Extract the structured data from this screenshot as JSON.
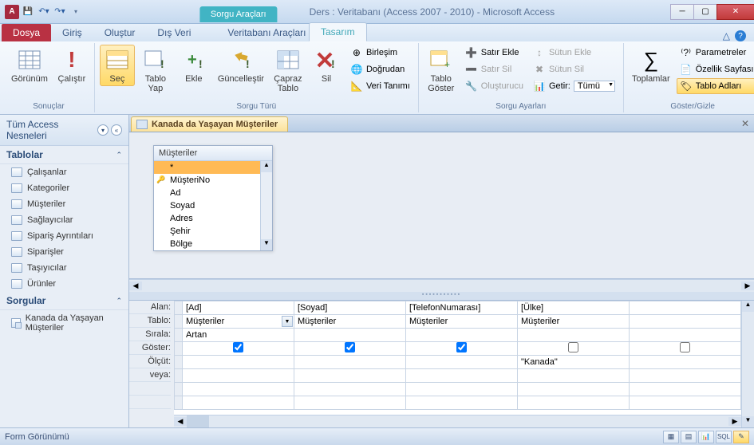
{
  "title": "Ders : Veritabanı (Access 2007 - 2010)  -  Microsoft Access",
  "contextual_tab_group": "Sorgu Araçları",
  "tabs": {
    "dosya": "Dosya",
    "giris": "Giriş",
    "olustur": "Oluştur",
    "disveri": "Dış Veri",
    "vt_araclari": "Veritabanı Araçları",
    "tasarim": "Tasarım"
  },
  "ribbon": {
    "sonuclar": {
      "label": "Sonuçlar",
      "gorunum": "Görünüm",
      "calistir": "Çalıştır"
    },
    "sorgu_turu": {
      "label": "Sorgu Türü",
      "sec": "Seç",
      "tablo_yap": "Tablo\nYap",
      "ekle": "Ekle",
      "guncelle": "Güncelleştir",
      "capraz": "Çapraz\nTablo",
      "sil": "Sil",
      "birlesim": "Birleşim",
      "dogrudan": "Doğrudan",
      "veri_tanimi": "Veri Tanımı"
    },
    "sorgu_ayarlari": {
      "label": "Sorgu Ayarları",
      "tablo_goster": "Tablo\nGöster",
      "satir_ekle": "Satır Ekle",
      "satir_sil": "Satır Sil",
      "olusturucu": "Oluşturucu",
      "sutun_ekle": "Sütun Ekle",
      "sutun_sil": "Sütun Sil",
      "getir": "Getir:",
      "getir_val": "Tümü"
    },
    "goster_gizle": {
      "label": "Göster/Gizle",
      "toplamlar": "Toplamlar",
      "parametreler": "Parametreler",
      "ozellik": "Özellik Sayfası",
      "tablo_adlari": "Tablo Adları"
    }
  },
  "nav": {
    "header": "Tüm Access Nesneleri",
    "tablolar": "Tablolar",
    "sorgular": "Sorgular",
    "items_tables": [
      "Çalışanlar",
      "Kategoriler",
      "Müşteriler",
      "Sağlayıcılar",
      "Sipariş Ayrıntıları",
      "Siparişler",
      "Taşıyıcılar",
      "Ürünler"
    ],
    "items_queries": [
      "Kanada da Yaşayan Müşteriler"
    ]
  },
  "query": {
    "tab_name": "Kanada da Yaşayan Müşteriler",
    "table_name": "Müşteriler",
    "fields": [
      "*",
      "MüşteriNo",
      "Ad",
      "Soyad",
      "Adres",
      "Şehir",
      "Bölge"
    ],
    "row_labels": {
      "alan": "Alan:",
      "tablo": "Tablo:",
      "sirala": "Sırala:",
      "goster": "Göster:",
      "olcut": "Ölçüt:",
      "veya": "veya:"
    },
    "cols": [
      {
        "alan": "[Ad]",
        "tablo": "Müşteriler",
        "sirala": "Artan",
        "goster": true,
        "olcut": "",
        "dd": true
      },
      {
        "alan": "[Soyad]",
        "tablo": "Müşteriler",
        "sirala": "",
        "goster": true,
        "olcut": ""
      },
      {
        "alan": "[TelefonNumarası]",
        "tablo": "Müşteriler",
        "sirala": "",
        "goster": true,
        "olcut": ""
      },
      {
        "alan": "[Ülke]",
        "tablo": "Müşteriler",
        "sirala": "",
        "goster": false,
        "olcut": "\"Kanada\""
      },
      {
        "alan": "",
        "tablo": "",
        "sirala": "",
        "goster": false,
        "olcut": ""
      }
    ]
  },
  "status": "Form Görünümü"
}
